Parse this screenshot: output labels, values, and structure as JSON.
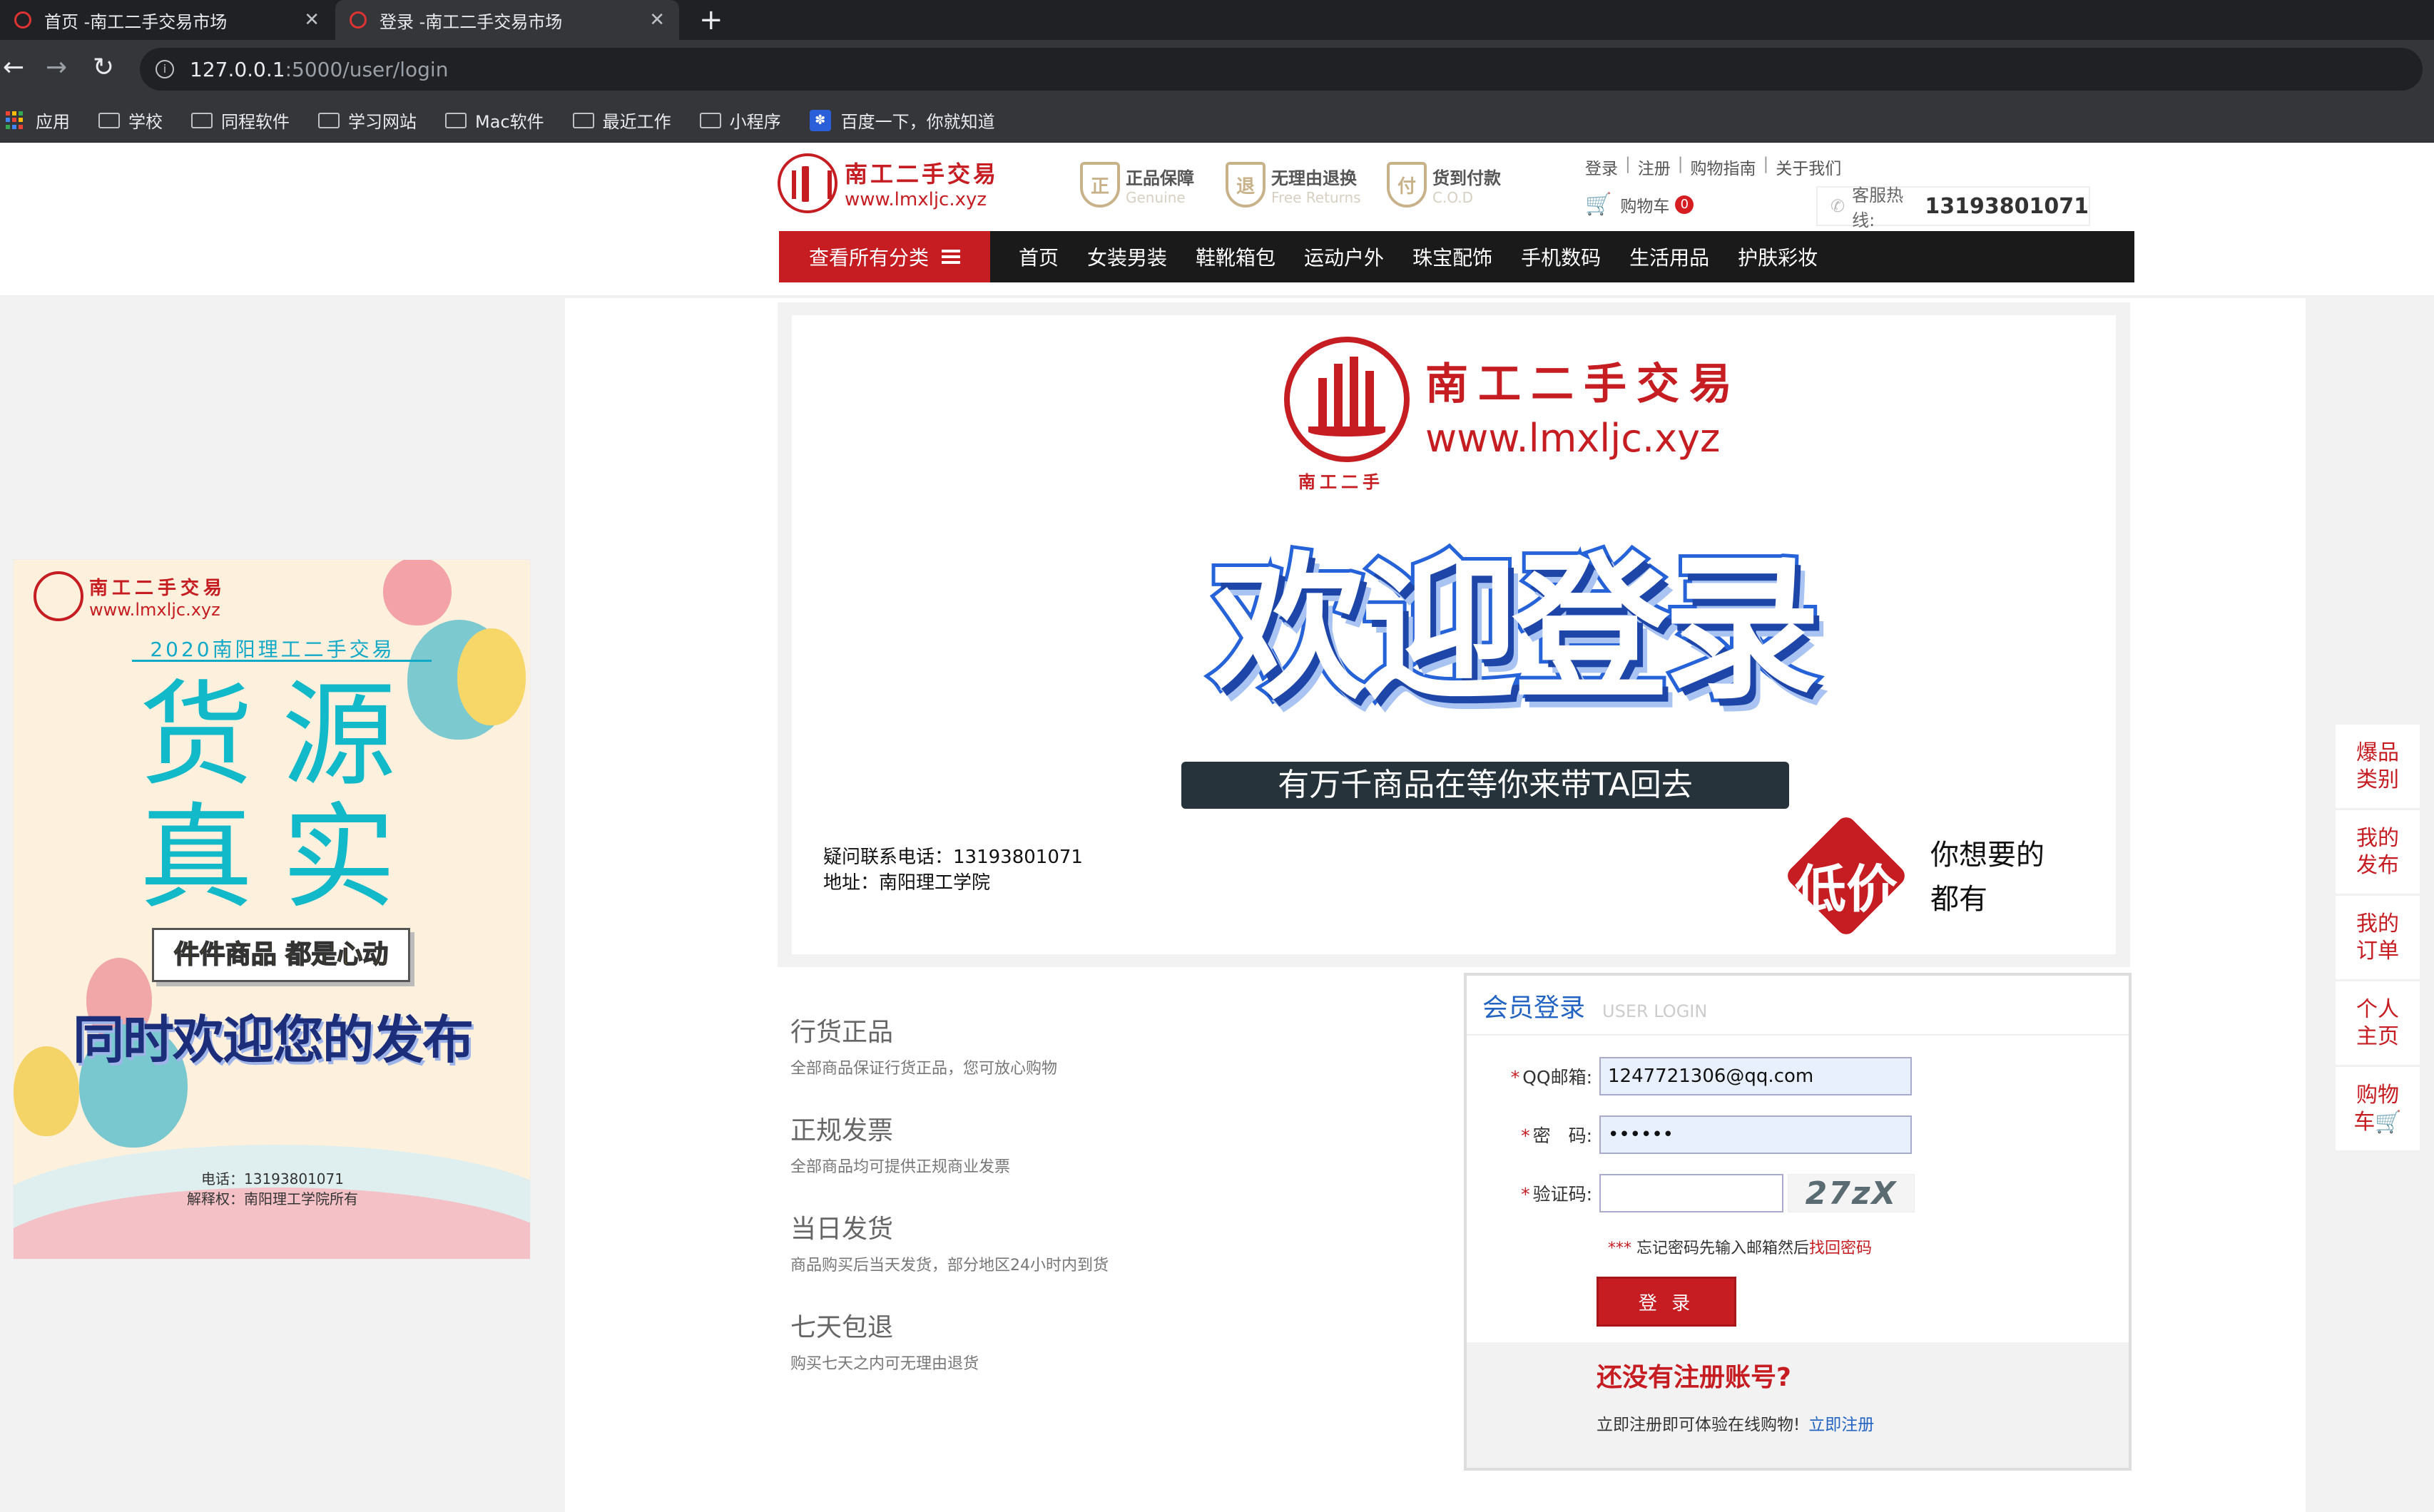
{
  "browser": {
    "tabs": [
      {
        "label": "首页 -南工二手交易市场"
      },
      {
        "label": "登录 -南工二手交易市场"
      }
    ],
    "new_tab": "+",
    "url_host": "127.0.0.1",
    "url_path": ":5000/user/login",
    "bookmarks": [
      "应用",
      "学校",
      "同程软件",
      "学习网站",
      "Mac软件",
      "最近工作",
      "小程序",
      "百度一下，你就知道"
    ]
  },
  "header": {
    "logo_cn": "南工二手交易",
    "logo_url": "www.lmxljc.xyz",
    "guarantees": [
      {
        "title": "正品保障",
        "sub": "Genuine",
        "icon": "正"
      },
      {
        "title": "无理由退换",
        "sub": "Free Returns",
        "icon": "退"
      },
      {
        "title": "货到付款",
        "sub": "C.O.D",
        "icon": "付"
      }
    ],
    "top_links": [
      "登录",
      "注册",
      "购物指南",
      "关于我们"
    ],
    "cart_label": "购物车",
    "cart_count": "0",
    "hotline_label": "客服热线:",
    "hotline_number": "13193801071"
  },
  "nav": {
    "category_button": "查看所有分类",
    "items": [
      "首页",
      "女装男装",
      "鞋靴箱包",
      "运动户外",
      "珠宝配饰",
      "手机数码",
      "生活用品",
      "护肤彩妆"
    ]
  },
  "banner": {
    "logo_cn": "南工二手交易",
    "logo_url": "www.lmxljc.xyz",
    "logo_sub": "南工二手",
    "welcome": "欢迎登录",
    "slogan": "有万千商品在等你来带TA回去",
    "phone_line": "疑问联系电话：13193801071",
    "address_line": "地址：南阳理工学院",
    "low_price": "低价",
    "you_want_1": "你想要的",
    "you_want_2": "都有"
  },
  "side_ad": {
    "logo_cn": "南工二手交易",
    "logo_url": "www.lmxljc.xyz",
    "year_line": "2020南阳理工二手交易",
    "big_line1": "货源",
    "big_line2": "真实",
    "box_text": "件件商品 都是心动",
    "welcome": "同时欢迎您的发布",
    "footer_phone": "电话：13193801071",
    "footer_rights": "解释权：南阳理工学院所有"
  },
  "features": [
    {
      "title": "行货正品",
      "desc": "全部商品保证行货正品，您可放心购物"
    },
    {
      "title": "正规发票",
      "desc": "全部商品均可提供正规商业发票"
    },
    {
      "title": "当日发货",
      "desc": "商品购买后当天发货，部分地区24小时内到货"
    },
    {
      "title": "七天包退",
      "desc": "购买七天之内可无理由退货"
    }
  ],
  "login": {
    "title": "会员登录",
    "subtitle": "USER LOGIN",
    "email_label": "QQ邮箱:",
    "email_value": "1247721306@qq.com",
    "password_label": "密　码:",
    "password_value": "••••••",
    "code_label": "验证码:",
    "code_value": "",
    "captcha_text": "27zX",
    "required_mark": "*",
    "forgot_stars": "***",
    "forgot_text": "忘记密码先输入邮箱然后",
    "forgot_link": "找回密码",
    "submit": "登 录",
    "register_title": "还没有注册账号?",
    "register_text": "立即注册即可体验在线购物!",
    "register_link": "立即注册"
  },
  "right_bar": [
    {
      "line1": "爆品",
      "line2": "类别"
    },
    {
      "line1": "我的",
      "line2": "发布"
    },
    {
      "line1": "我的",
      "line2": "订单"
    },
    {
      "line1": "个人",
      "line2": "主页"
    },
    {
      "line1": "购物",
      "line2": "车🛒"
    }
  ]
}
